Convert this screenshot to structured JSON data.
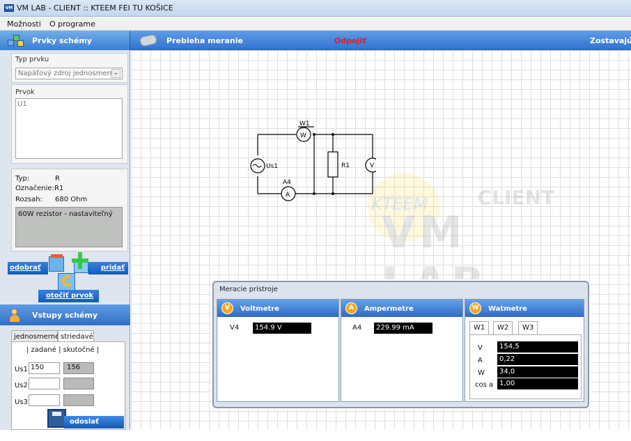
{
  "window": {
    "title": "VM LAB - CLIENT :: KTEEM FEI TU KOŠICE",
    "app_icon": "VM"
  },
  "menu": {
    "items": [
      "Možnosti",
      "O programe"
    ]
  },
  "toolbar": {
    "status": "Prebieha meranie",
    "disconnect": "Odpojiť",
    "remaining": "Zostavajúci"
  },
  "left_panel": {
    "title": "Prvky schémy",
    "type_label": "Typ prvku",
    "type_value": "Napäťový zdroj jednosmerný",
    "element_label": "Prvok",
    "element_value": "U1",
    "info": {
      "type_label": "Typ:",
      "type_value": "R",
      "designation_label": "Označenie:",
      "designation_value": "R1",
      "range_label": "Rozsah:",
      "range_value": "680 Ohm"
    },
    "description": "60W rezistor  - nastaviteľný",
    "buttons": {
      "remove": "odobrať",
      "add": "pridať",
      "rotate": "otočiť prvok"
    }
  },
  "inputs_panel": {
    "title": "Vstupy schémy",
    "tabs": [
      "jednosmerné",
      "striedavé"
    ],
    "column_headers": "| zadané    | skutočné  |",
    "rows": [
      {
        "label": "Us1",
        "given": "150",
        "actual": "156"
      },
      {
        "label": "Us2",
        "given": "",
        "actual": ""
      },
      {
        "label": "Us3",
        "given": "",
        "actual": ""
      }
    ],
    "send_button": "odoslať vstupy"
  },
  "circuit": {
    "labels": [
      "W1",
      "W",
      "Us1",
      "A4",
      "A",
      "R1",
      "V",
      "V4"
    ]
  },
  "watermark": {
    "logo": "KTEEM",
    "word": "VM LAB",
    "client": "CLIENT"
  },
  "meters": {
    "title": "Meracie prístroje",
    "voltmeters": {
      "icon": "V",
      "title": "Voltmetre",
      "label": "V4",
      "value": "154.9 V"
    },
    "ammeters": {
      "icon": "A",
      "title": "Ampermetre",
      "label": "A4",
      "value": "229.99 mA"
    },
    "wattmeters": {
      "icon": "W",
      "title": "Watmetre",
      "tabs": [
        "W1",
        "W2",
        "W3"
      ],
      "rows": [
        {
          "label": "V",
          "value": "154,5"
        },
        {
          "label": "A",
          "value": "0,22"
        },
        {
          "label": "W",
          "value": "34,0"
        },
        {
          "label": "cos a",
          "value": "1,00"
        }
      ]
    }
  },
  "colors": {
    "accent_blue": "#3f7fd6",
    "warning_red": "#e11b1b",
    "badge_orange": "#f7a51d"
  }
}
